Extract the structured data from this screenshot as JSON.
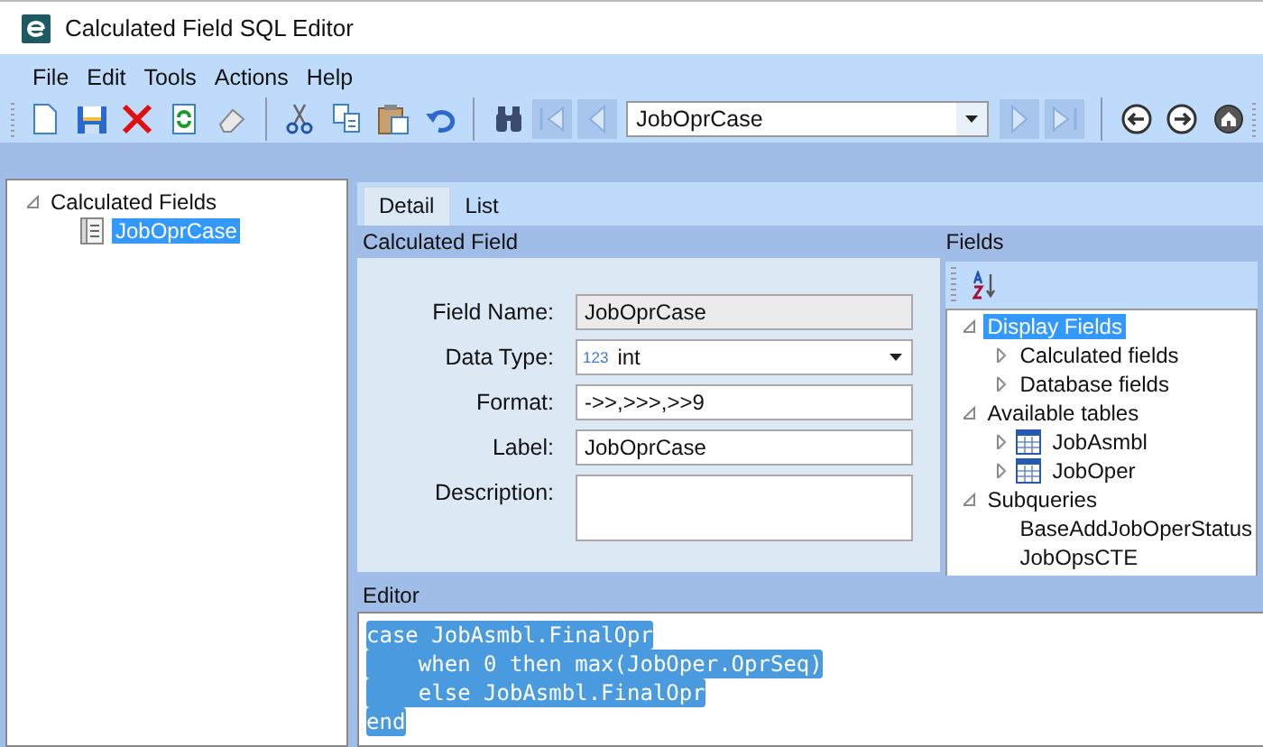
{
  "window": {
    "title": "Calculated Field SQL Editor"
  },
  "menu": [
    "File",
    "Edit",
    "Tools",
    "Actions",
    "Help"
  ],
  "record_selector": {
    "value": "JobOprCase"
  },
  "tree": [
    {
      "label": "Calculated Fields",
      "expanded": true,
      "children": [
        {
          "label": "JobOprCase",
          "selected": true
        }
      ]
    }
  ],
  "tabs": [
    {
      "label": "Detail",
      "selected": true
    },
    {
      "label": "List",
      "selected": false
    }
  ],
  "detail": {
    "title": "Calculated Field",
    "fields": [
      {
        "kind": "readonly",
        "label": "Field Name:",
        "value": "JobOprCase"
      },
      {
        "kind": "dropdown",
        "label": "Data Type:",
        "badge": "123",
        "value": "int"
      },
      {
        "kind": "text",
        "label": "Format:",
        "value": "->>,>>>,>>9"
      },
      {
        "kind": "text",
        "label": "Label:",
        "value": "JobOprCase"
      },
      {
        "kind": "textarea",
        "label": "Description:"
      }
    ]
  },
  "fields_panel": {
    "title": "Fields",
    "tree": [
      {
        "label": "Display Fields",
        "selected": true,
        "expanded": true,
        "children": [
          {
            "label": "Calculated fields",
            "expanded": false,
            "selected": false
          },
          {
            "label": "Database fields",
            "expanded": false,
            "selected": false
          }
        ]
      },
      {
        "label": "Available tables",
        "selected": false,
        "expanded": true,
        "children": [
          {
            "label": "JobAsmbl",
            "kind": "table",
            "expanded": false,
            "selected": false
          },
          {
            "label": "JobOper",
            "kind": "table",
            "expanded": false,
            "selected": false
          }
        ]
      },
      {
        "label": "Subqueries",
        "selected": false,
        "expanded": true,
        "children": [
          {
            "label": "BaseAddJobOperStatus",
            "selected": false
          },
          {
            "label": "JobOpsCTE",
            "selected": false
          }
        ]
      }
    ]
  },
  "editor": {
    "title": "Editor",
    "selected": true,
    "lines": [
      "case JobAsmbl.FinalOpr",
      "    when 0 then max(JobOper.OprSeq)",
      "    else JobAsmbl.FinalOpr",
      "end"
    ]
  }
}
